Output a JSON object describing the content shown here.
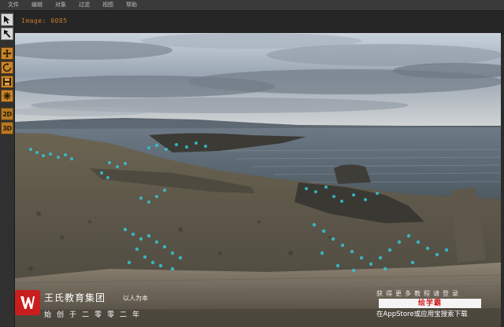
{
  "menu": {
    "items": [
      "文件",
      "编辑",
      "对象",
      "过滤",
      "视图",
      "帮助"
    ]
  },
  "toolbar": {
    "tools": [
      {
        "name": "select-arrow-icon",
        "style": "light"
      },
      {
        "name": "pen-tool-icon",
        "style": "light"
      },
      {
        "name": "move-icon",
        "style": "orange"
      },
      {
        "name": "rotate-icon",
        "style": "orange"
      },
      {
        "name": "save-icon",
        "style": "orange"
      },
      {
        "name": "transform-icon",
        "style": "orange"
      },
      {
        "name": "2d-button",
        "style": "orange-grid",
        "label": "2D"
      },
      {
        "name": "3d-button",
        "style": "orange-grid",
        "label": "3D"
      }
    ]
  },
  "viewer": {
    "image_label": "Image: 0085"
  },
  "watermark": {
    "group_name": "王氏教育集团",
    "slogan": "以人为本",
    "founded": "始创于二零零二年",
    "more_text": "获得更多教程请登录",
    "site_name": "绘学霸",
    "appstore_text": "在AppStore或应用宝搜索下载",
    "logo_color": "#c81e1e"
  },
  "colors": {
    "accent_orange": "#c97a2a",
    "tracker_points": "#35c6d8"
  }
}
